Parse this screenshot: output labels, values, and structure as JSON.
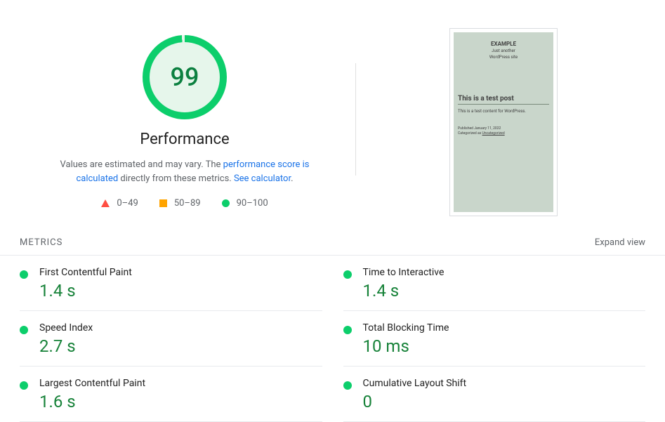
{
  "score": {
    "value": "99",
    "label": "Performance"
  },
  "disclaimer": {
    "prefix": "Values are estimated and may vary. The ",
    "link1": "performance score is calculated",
    "middle": " directly from these metrics. ",
    "link2": "See calculator"
  },
  "legend": {
    "low": "0–49",
    "mid": "50–89",
    "high": "90–100"
  },
  "thumbnail": {
    "site_title": "EXAMPLE",
    "site_tagline1": "Just another",
    "site_tagline2": "WordPress site",
    "post_title": "This is a test post",
    "post_content": "This is a test content for WordPress.",
    "published": "Published January 11, 2022",
    "categorized_prefix": "Categorized as ",
    "category": "Uncategorized"
  },
  "metrics_header": {
    "label": "METRICS",
    "expand": "Expand view"
  },
  "metrics": {
    "fcp": {
      "name": "First Contentful Paint",
      "value": "1.4 s"
    },
    "tti": {
      "name": "Time to Interactive",
      "value": "1.4 s"
    },
    "si": {
      "name": "Speed Index",
      "value": "2.7 s"
    },
    "tbt": {
      "name": "Total Blocking Time",
      "value": "10 ms"
    },
    "lcp": {
      "name": "Largest Contentful Paint",
      "value": "1.6 s"
    },
    "cls": {
      "name": "Cumulative Layout Shift",
      "value": "0"
    }
  }
}
